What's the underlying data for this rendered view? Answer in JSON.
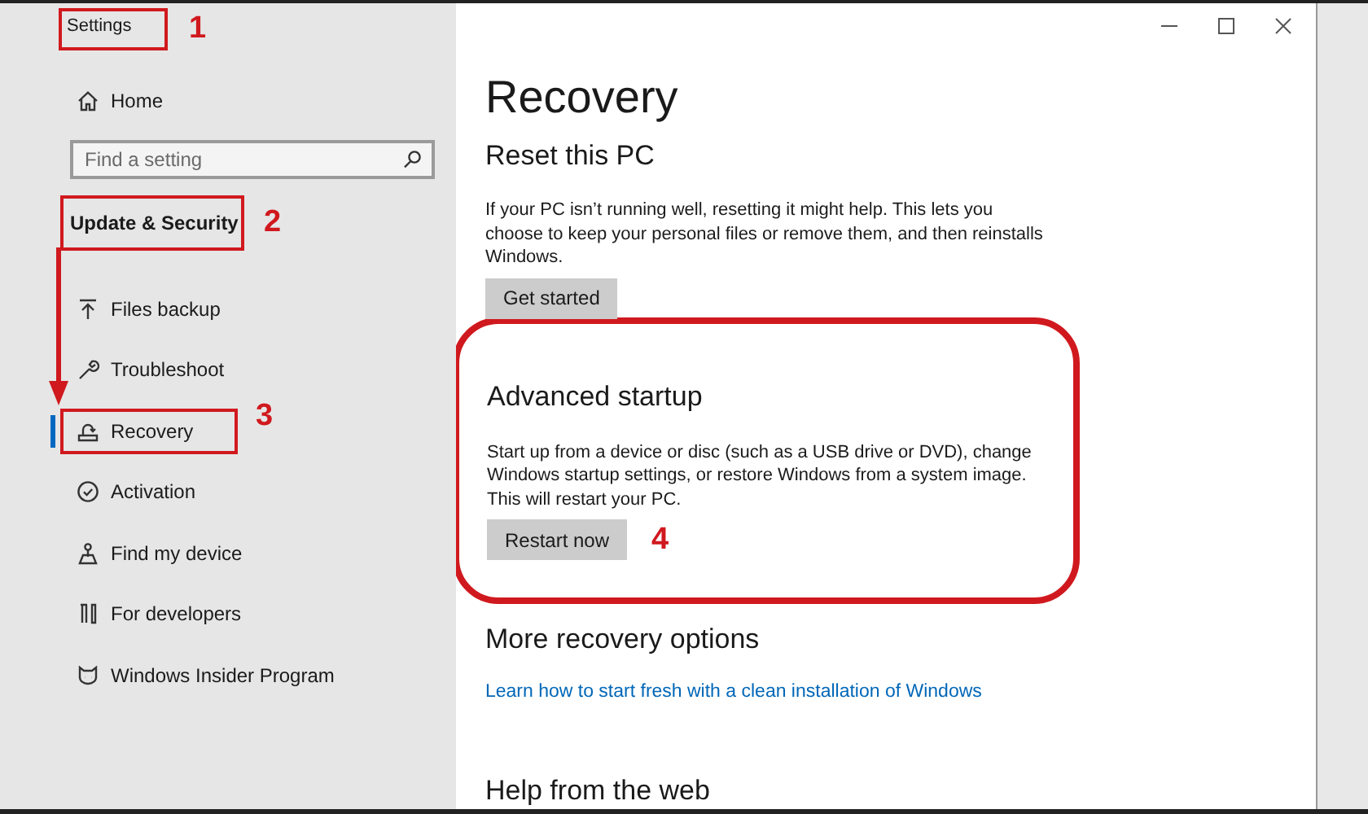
{
  "window": {
    "title": "Settings",
    "callout": "1"
  },
  "sidebar": {
    "home": "Home",
    "search": {
      "placeholder": "Find a setting"
    },
    "section": {
      "label": "Update & Security",
      "callout": "2"
    },
    "items": [
      {
        "label": "Files backup",
        "selected": false
      },
      {
        "label": "Troubleshoot",
        "selected": false
      },
      {
        "label": "Recovery",
        "selected": true,
        "callout": "3"
      },
      {
        "label": "Activation",
        "selected": false
      },
      {
        "label": "Find my device",
        "selected": false
      },
      {
        "label": "For developers",
        "selected": false
      },
      {
        "label": "Windows Insider Program",
        "selected": false
      }
    ]
  },
  "main": {
    "title": "Recovery",
    "sections": [
      {
        "heading": "Reset this PC",
        "text": "If your PC isn’t running well, resetting it might help. This lets you choose to keep your personal files or remove them, and then reinstalls Windows.",
        "button": "Get started"
      },
      {
        "heading": "Advanced startup",
        "text": "Start up from a device or disc (such as a USB drive or DVD), change Windows startup settings, or restore Windows from a system image. This will restart your PC.",
        "button": "Restart now",
        "callout": "4"
      },
      {
        "heading": "More recovery options",
        "link": "Learn how to start fresh with a clean installation of Windows"
      },
      {
        "heading": "Help from the web"
      }
    ]
  }
}
